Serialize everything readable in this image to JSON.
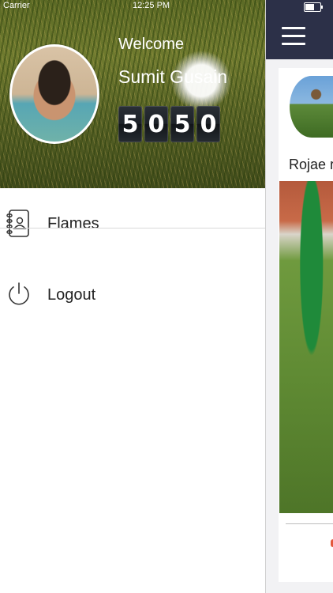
{
  "status_bar": {
    "carrier": "Carrier",
    "time": "12:25 PM"
  },
  "drawer": {
    "welcome": "Welcome",
    "user_name": "Sumit Gusain",
    "score_digits": [
      "5",
      "0",
      "5",
      "0"
    ],
    "menu": [
      {
        "label": "Flames",
        "icon": "contacts-book-icon"
      },
      {
        "label": "Logout",
        "icon": "power-icon"
      }
    ]
  },
  "feed": {
    "post_author": "Rojae r"
  },
  "colors": {
    "navbar": "#2c3048",
    "drawer_bg": "#ffffff",
    "accent_dot": "#e4573b"
  }
}
